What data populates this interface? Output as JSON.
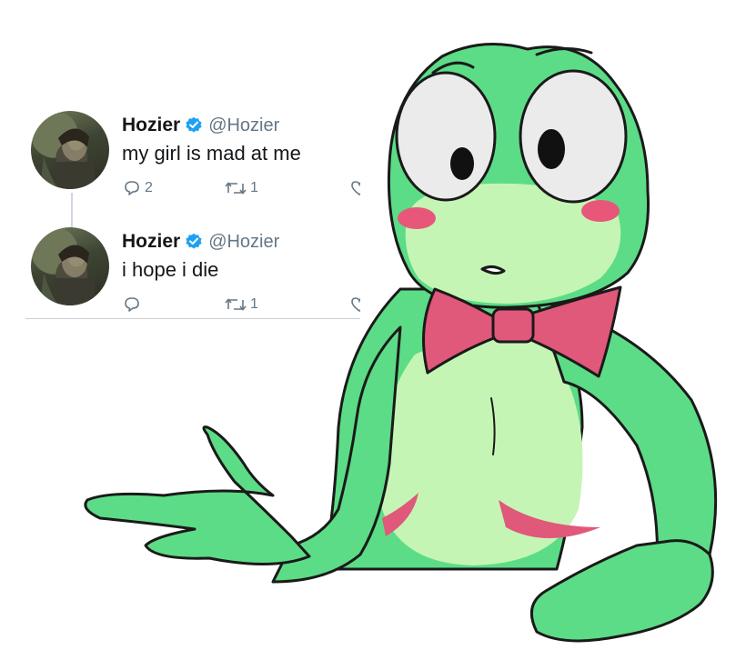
{
  "tweets": [
    {
      "display_name": "Hozier",
      "handle": "@Hozier",
      "text": "my girl is mad at me",
      "reply_count": "2",
      "retweet_count": "1",
      "verified": true,
      "icons": [
        "avatar",
        "verified-badge-icon",
        "reply-icon",
        "retweet-icon",
        "like-icon"
      ]
    },
    {
      "display_name": "Hozier",
      "handle": "@Hozier",
      "text": "i hope i die",
      "reply_count": "",
      "retweet_count": "1",
      "verified": true,
      "icons": [
        "avatar",
        "verified-badge-icon",
        "reply-icon",
        "retweet-icon",
        "like-icon"
      ]
    }
  ],
  "colors": {
    "verified_blue": "#1da1f2",
    "meta_gray": "#657786",
    "frog_green": "#5cdc86",
    "frog_belly": "#c5f5b5",
    "bowtie_pink": "#e0587a",
    "cheek_pink": "#e8577a"
  }
}
